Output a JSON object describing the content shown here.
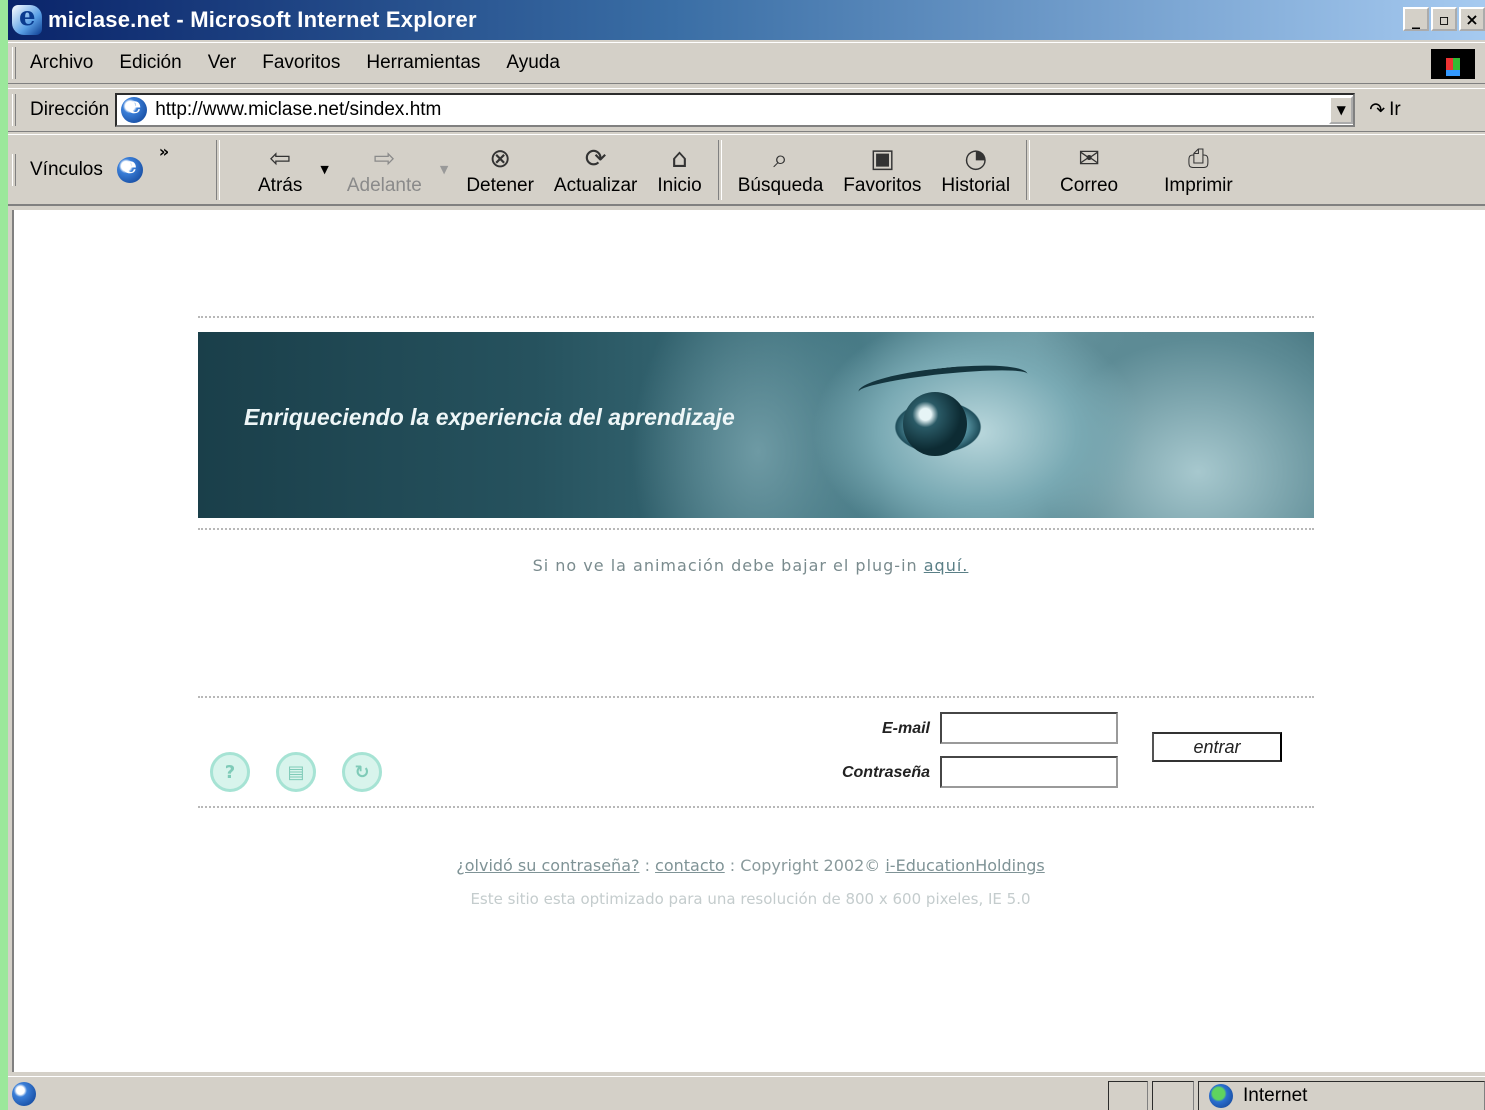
{
  "window": {
    "title": "miclase.net - Microsoft Internet Explorer",
    "buttons": [
      "_",
      "▫",
      "×"
    ]
  },
  "menu": {
    "items": [
      "Archivo",
      "Edición",
      "Ver",
      "Favoritos",
      "Herramientas",
      "Ayuda"
    ]
  },
  "address": {
    "label": "Dirección",
    "url": "http://www.miclase.net/sindex.htm",
    "go_label": "Ir"
  },
  "toolbar": {
    "links_label": "Vínculos",
    "back": "Atrás",
    "forward": "Adelante",
    "stop": "Detener",
    "refresh": "Actualizar",
    "home": "Inicio",
    "search": "Búsqueda",
    "favorites": "Favoritos",
    "history": "Historial",
    "mail": "Correo",
    "print": "Imprimir"
  },
  "page": {
    "tagline": "Enriqueciendo la experiencia del aprendizaje",
    "plugin_note": "Si no ve la animación debe bajar el plug-in ",
    "plugin_link": "aquí.",
    "email_label": "E-mail",
    "password_label": "Contraseña",
    "email_value": "",
    "password_value": "",
    "submit_label": "entrar",
    "forgot_link": "¿olvidó su contraseña?",
    "sep1": " : ",
    "contact_link": "contacto",
    "copyright": " : Copyright 2002© ",
    "company_link": "i-EducationHoldings",
    "optimized_note": "Este sitio esta optimizado para una resolución de 800 x 600 pixeles, IE 5.0"
  },
  "status": {
    "zone": "Internet"
  },
  "colors": {
    "desktop": "#9be89b",
    "chrome": "#d4d0c8",
    "title_start": "#0a246a",
    "icon_teal": "#a6e3d4"
  }
}
